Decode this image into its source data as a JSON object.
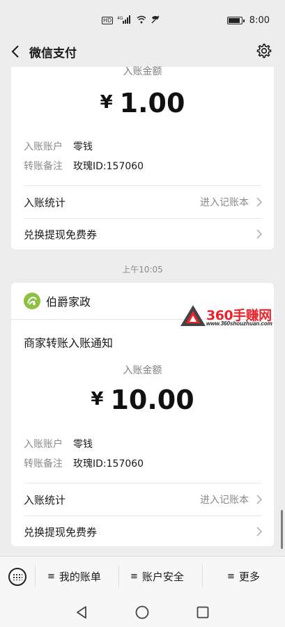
{
  "status_bar": {
    "time": "8:00",
    "network": "4G",
    "hd": "HD",
    "battery_level": 0.9
  },
  "nav": {
    "title": "微信支付"
  },
  "card1": {
    "amount_label": "入账金额",
    "currency": "¥",
    "amount": "1.00",
    "account_key": "入账账户",
    "account_value": "零钱",
    "note_key": "转账备注",
    "note_value": "玫瑰ID:157060",
    "stats_label": "入账统计",
    "stats_link": "进入记账本",
    "coupon_label": "兑换提现免费券"
  },
  "timestamp": "上午10:05",
  "card2": {
    "merchant_name": "伯爵家政",
    "notify_title": "商家转账入账通知",
    "amount_label": "入账金额",
    "currency": "¥",
    "amount": "10.00",
    "account_key": "入账账户",
    "account_value": "零钱",
    "note_key": "转账备注",
    "note_value": "玫瑰ID:157060",
    "stats_label": "入账统计",
    "stats_link": "进入记账本",
    "coupon_label": "兑换提现免费券"
  },
  "watermark": {
    "name": "360手赚网",
    "url": "www.360shouzhuan.com"
  },
  "bottom_menu": {
    "items": [
      {
        "label": "我的账单"
      },
      {
        "label": "账户安全"
      },
      {
        "label": "更多"
      }
    ],
    "menu_glyph": "≡"
  },
  "colors": {
    "background": "#ededed",
    "card": "#ffffff",
    "merchant_logo": "#8cc23f",
    "watermark_red": "#e8242d"
  }
}
